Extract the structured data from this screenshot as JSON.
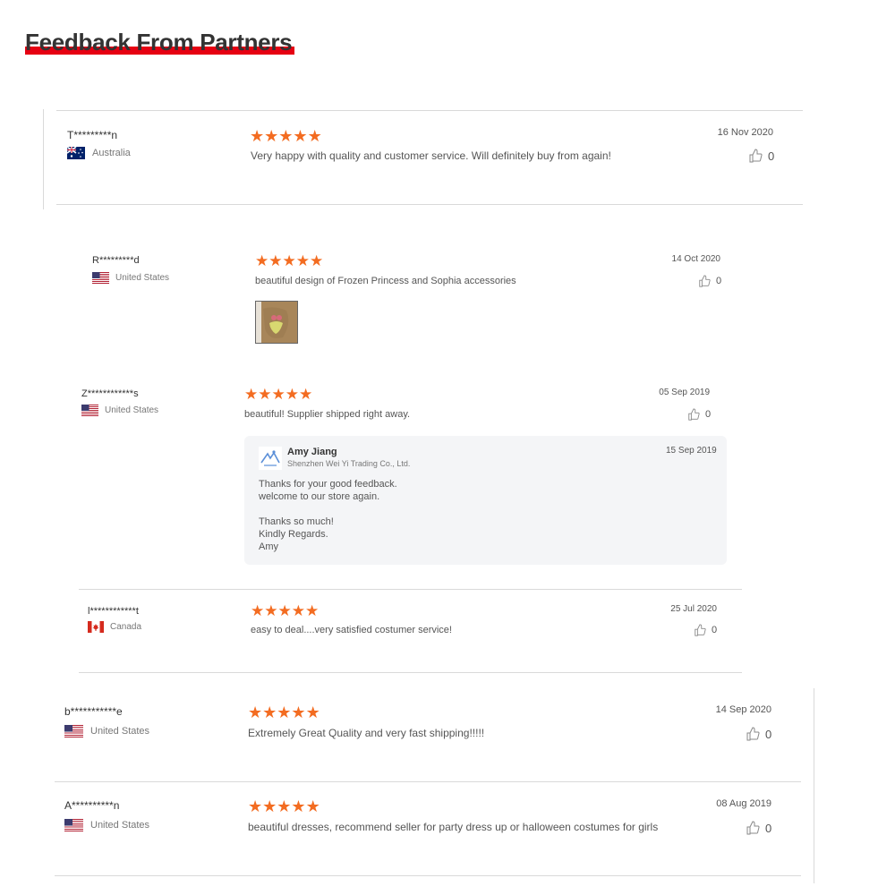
{
  "page_title": "Feedback From Partners",
  "accent_color": "#e60012",
  "star_color": "#f36c21",
  "reviews": [
    {
      "name": "T*********n",
      "country": "Australia",
      "flag": "australia-flag",
      "stars": 5,
      "date": "16 Nov 2020",
      "text": "Very happy with quality and customer service. Will definitely buy from again!",
      "likes": "0"
    },
    {
      "name": "R*********d",
      "country": "United States",
      "flag": "us-flag",
      "stars": 5,
      "date": "14 Oct 2020",
      "text": "beautiful design of Frozen Princess and Sophia accessories",
      "likes": "0"
    },
    {
      "name": "Z************s",
      "country": "United States",
      "flag": "us-flag",
      "stars": 5,
      "date": "05 Sep 2019",
      "text": "beautiful! Supplier shipped right away.",
      "likes": "0",
      "reply": {
        "name": "Amy Jiang",
        "company": "Shenzhen Wei Yi Trading Co., Ltd.",
        "date": "15 Sep 2019",
        "lines": [
          "Thanks for your good feedback.",
          "welcome to our store again.",
          "",
          "Thanks so much!",
          "Kindly Regards.",
          "Amy"
        ]
      }
    },
    {
      "name": "l************t",
      "country": "Canada",
      "flag": "canada-flag",
      "stars": 5,
      "date": "25 Jul 2020",
      "text": "easy to deal....very satisfied costumer service!",
      "likes": "0"
    },
    {
      "name": "b***********e",
      "country": "United States",
      "flag": "us-flag",
      "stars": 5,
      "date": "14 Sep 2020",
      "text": "Extremely Great Quality and very fast shipping!!!!!",
      "likes": "0"
    },
    {
      "name": "A**********n",
      "country": "United States",
      "flag": "us-flag",
      "stars": 5,
      "date": "08 Aug 2019",
      "text": "beautiful dresses, recommend seller for party dress up or halloween costumes for girls",
      "likes": "0"
    }
  ]
}
